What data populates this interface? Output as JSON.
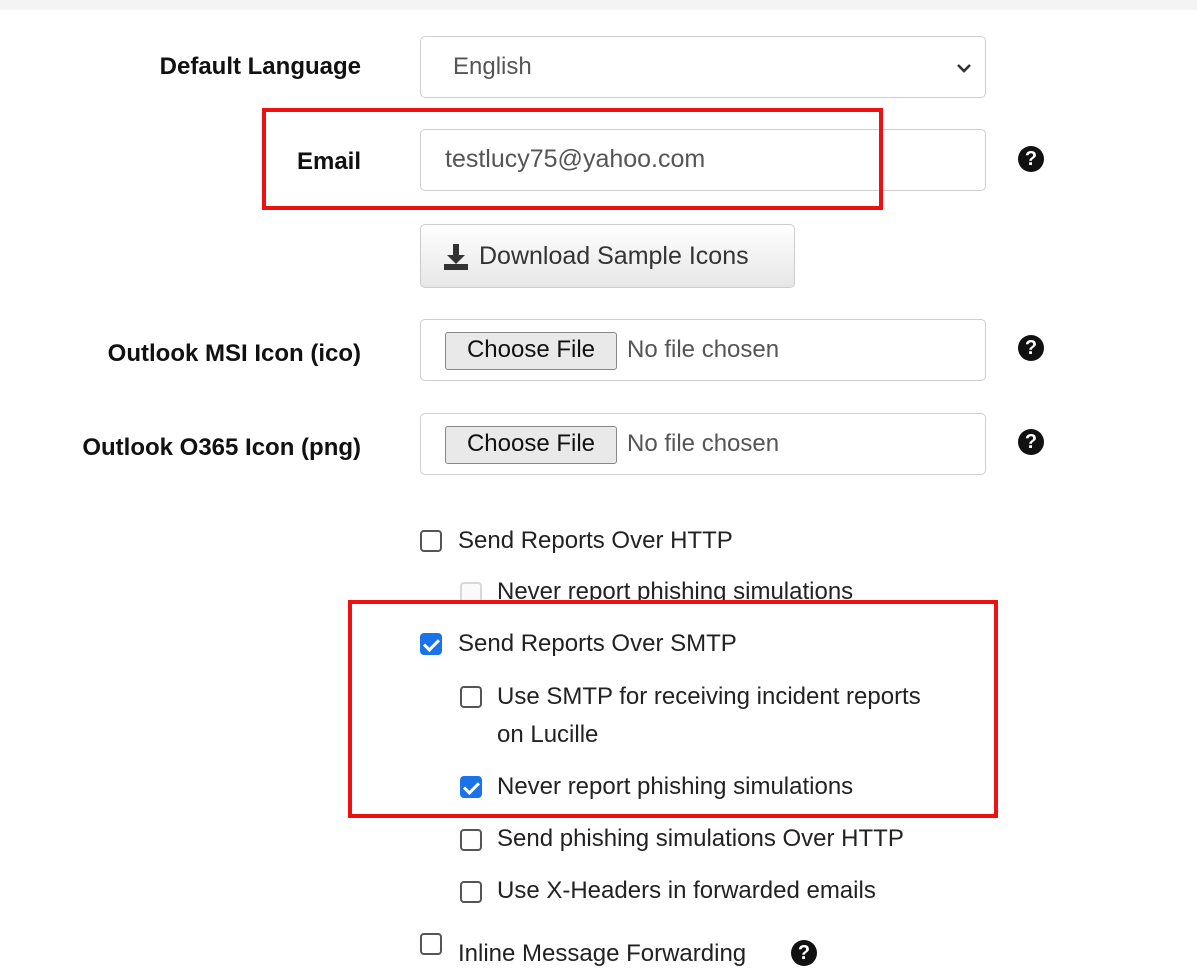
{
  "form": {
    "language": {
      "label": "Default Language",
      "value": "English"
    },
    "email": {
      "label": "Email",
      "value": "testlucy75@yahoo.com"
    },
    "download_button": "Download Sample Icons",
    "outlook_msi": {
      "label": "Outlook MSI Icon (ico)",
      "button": "Choose File",
      "status": "No file chosen"
    },
    "outlook_o365": {
      "label": "Outlook O365 Icon (png)",
      "button": "Choose File",
      "status": "No file chosen"
    },
    "help_glyph": "?",
    "options": {
      "send_http": {
        "label": "Send Reports Over HTTP",
        "checked": false
      },
      "never_report_http": {
        "label": "Never report phishing simulations",
        "checked": false,
        "disabled": true
      },
      "send_smtp": {
        "label": "Send Reports Over SMTP",
        "checked": true
      },
      "use_smtp_incident": {
        "label_line1": "Use SMTP for receiving incident reports",
        "label_line2": "on Lucille",
        "checked": false
      },
      "never_report_smtp": {
        "label": "Never report phishing simulations",
        "checked": true
      },
      "send_phishing_http": {
        "label": "Send phishing simulations Over HTTP",
        "checked": false
      },
      "use_xheaders": {
        "label": "Use X-Headers in forwarded emails",
        "checked": false
      },
      "inline_forwarding": {
        "label": "Inline Message Forwarding",
        "checked": false
      }
    }
  },
  "colors": {
    "highlight": "#ee1111",
    "checkbox_checked": "#1a73e8"
  },
  "icons": {
    "help": "question-circle-icon",
    "download": "download-icon",
    "select": "chevron-down-icon"
  }
}
